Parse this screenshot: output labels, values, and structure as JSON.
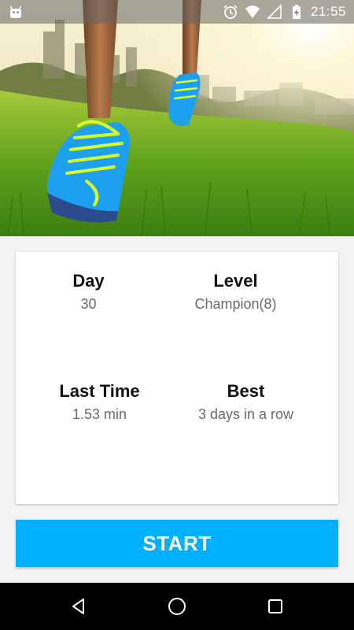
{
  "status_bar": {
    "time": "21:55",
    "icons": [
      "android-icon",
      "alarm-icon",
      "wifi-icon",
      "signal-icon",
      "battery-charging-icon"
    ]
  },
  "hero": {
    "image": "running-shoes-on-grass-city-skyline"
  },
  "stats": {
    "day": {
      "label": "Day",
      "value": "30"
    },
    "level": {
      "label": "Level",
      "value": "Champion(8)"
    },
    "last_time": {
      "label": "Last Time",
      "value": "1.53 min"
    },
    "best": {
      "label": "Best",
      "value": "3 days in a row"
    }
  },
  "start_button": {
    "label": "START"
  },
  "nav_bar": {
    "icons": [
      "back-icon",
      "home-icon",
      "recents-icon"
    ]
  },
  "colors": {
    "accent": "#00b0ff",
    "card_bg": "#ffffff",
    "page_bg": "#f3f3f3",
    "label_text": "#111111",
    "value_text": "#6a6a6a",
    "nav_bg": "#000000"
  }
}
